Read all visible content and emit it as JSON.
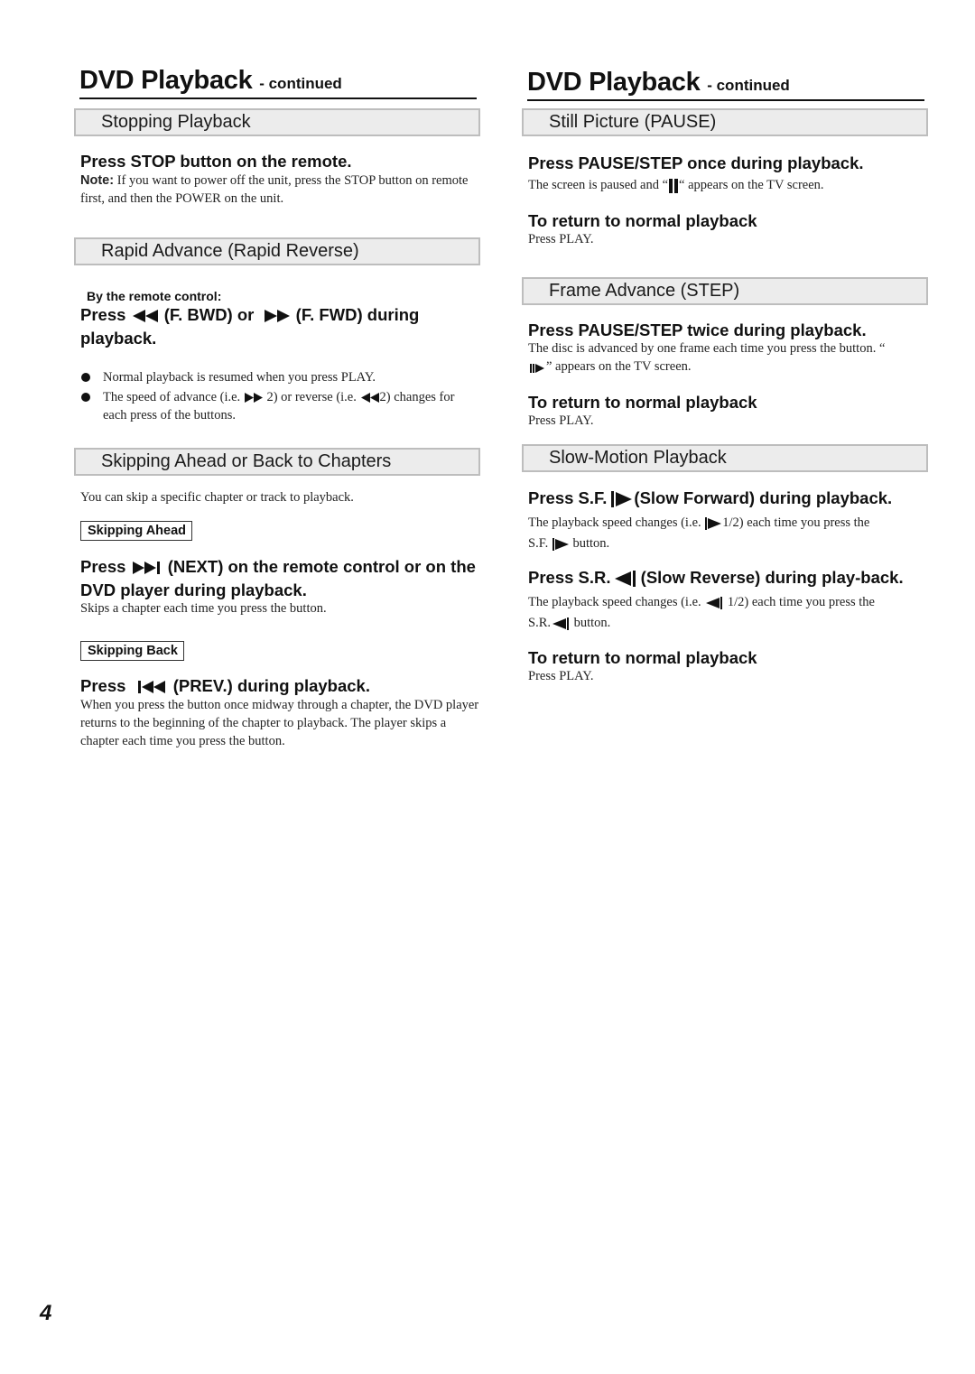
{
  "left": {
    "title": "DVD Playback",
    "title_suffix": "- continued",
    "stopping": {
      "bar": "Stopping Playback",
      "heading": "Press STOP button on the remote.",
      "note_label": "Note:",
      "note_text": " If you want to power off the unit, press the STOP button on remote first, and then the POWER on the unit."
    },
    "rapid": {
      "bar": "Rapid Advance (Rapid Reverse)",
      "by_remote": "By the remote control:",
      "heading_press": "Press",
      "heading_fbwd": "(F. BWD) or",
      "heading_ffwd": "(F. FWD) during playback.",
      "bullet1": "Normal playback is resumed when you press PLAY.",
      "bullet2_a": "The speed of advance (i.e.",
      "bullet2_b": "2) or reverse (i.e.",
      "bullet2_c": "2) changes for each press of the buttons."
    },
    "skipping": {
      "bar": "Skipping Ahead or Back to Chapters",
      "intro": "You can skip a specific chapter or track to playback.",
      "ahead_tag": "Skipping Ahead",
      "ahead_press": "Press",
      "ahead_heading": "(NEXT) on the remote control or on the DVD player during playback.",
      "ahead_text": "Skips a chapter each time you press the button.",
      "back_tag": "Skipping Back",
      "back_press": "Press",
      "back_heading": "(PREV.) during playback.",
      "back_text": "When you press the button once midway through a chapter, the DVD player returns to the beginning of the chapter to playback. The player skips a chapter each time you press the button."
    }
  },
  "right": {
    "title": "DVD Playback",
    "title_suffix": "- continued",
    "pause": {
      "bar": "Still Picture (PAUSE)",
      "heading": "Press PAUSE/STEP once during playback.",
      "text_a": "The screen is paused and “",
      "text_b": "“ appears on the TV screen.",
      "return_heading": "To return to normal playback",
      "return_text": "Press PLAY."
    },
    "step": {
      "bar": "Frame Advance (STEP)",
      "heading": "Press PAUSE/STEP twice during playback.",
      "text_a": "The disc is advanced by one frame each time you press the button. “",
      "text_b": "” appears on  the TV screen.",
      "return_heading": "To return to normal playback",
      "return_text": "Press PLAY."
    },
    "slow": {
      "bar": "Slow-Motion Playback",
      "sf_press": "Press S.F.",
      "sf_heading": "(Slow Forward) during playback.",
      "sf_text_a": "The playback speed changes (i.e.",
      "sf_text_b": "1/2) each time you press the",
      "sf_text_c": "S.F.",
      "sf_text_d": "button.",
      "sr_press": "Press S.R.",
      "sr_heading": "(Slow Reverse) during play-back.",
      "sr_text_a": "The playback speed changes (i.e.",
      "sr_text_b": "1/2) each time you press the",
      "sr_text_c": "S.R.",
      "sr_text_d": "button.",
      "return_heading": "To return to normal playback",
      "return_text": "Press PLAY."
    }
  },
  "page_number": "4"
}
